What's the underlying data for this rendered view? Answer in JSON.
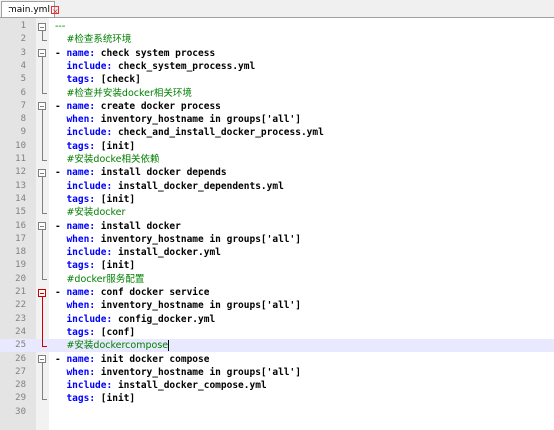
{
  "tab": {
    "filename": "main.yml",
    "close_icon": "close-icon",
    "file_icon": "file-icon"
  },
  "lines": [
    {
      "n": "1",
      "parts": [
        {
          "t": "---",
          "cls": "c"
        }
      ]
    },
    {
      "n": "2",
      "parts": [
        {
          "t": "  ",
          "cls": ""
        },
        {
          "t": "#检查系统环境",
          "cls": "c"
        }
      ]
    },
    {
      "n": "3",
      "parts": [
        {
          "t": "- ",
          "cls": ""
        },
        {
          "t": "name:",
          "cls": "k"
        },
        {
          "t": " check system process",
          "cls": ""
        }
      ]
    },
    {
      "n": "4",
      "parts": [
        {
          "t": "  ",
          "cls": ""
        },
        {
          "t": "include:",
          "cls": "k"
        },
        {
          "t": " check_system_process.yml",
          "cls": ""
        }
      ]
    },
    {
      "n": "5",
      "parts": [
        {
          "t": "  ",
          "cls": ""
        },
        {
          "t": "tags:",
          "cls": "k"
        },
        {
          "t": " [check]",
          "cls": ""
        }
      ]
    },
    {
      "n": "6",
      "parts": [
        {
          "t": "  ",
          "cls": ""
        },
        {
          "t": "#检查并安装docker相关环境",
          "cls": "c"
        }
      ]
    },
    {
      "n": "7",
      "parts": [
        {
          "t": "- ",
          "cls": ""
        },
        {
          "t": "name:",
          "cls": "k"
        },
        {
          "t": " create docker process",
          "cls": ""
        }
      ]
    },
    {
      "n": "8",
      "parts": [
        {
          "t": "  ",
          "cls": ""
        },
        {
          "t": "when:",
          "cls": "k"
        },
        {
          "t": " inventory_hostname in groups['all']",
          "cls": ""
        }
      ]
    },
    {
      "n": "9",
      "parts": [
        {
          "t": "  ",
          "cls": ""
        },
        {
          "t": "include:",
          "cls": "k"
        },
        {
          "t": " check_and_install_docker_process.yml",
          "cls": ""
        }
      ]
    },
    {
      "n": "10",
      "parts": [
        {
          "t": "  ",
          "cls": ""
        },
        {
          "t": "tags:",
          "cls": "k"
        },
        {
          "t": " [init]",
          "cls": ""
        }
      ]
    },
    {
      "n": "11",
      "parts": [
        {
          "t": "  ",
          "cls": ""
        },
        {
          "t": "#安装docke相关依赖",
          "cls": "c"
        }
      ]
    },
    {
      "n": "12",
      "parts": [
        {
          "t": "- ",
          "cls": ""
        },
        {
          "t": "name:",
          "cls": "k"
        },
        {
          "t": " install docker depends",
          "cls": ""
        }
      ]
    },
    {
      "n": "13",
      "parts": [
        {
          "t": "  ",
          "cls": ""
        },
        {
          "t": "include:",
          "cls": "k"
        },
        {
          "t": " install_docker_dependents.yml",
          "cls": ""
        }
      ]
    },
    {
      "n": "14",
      "parts": [
        {
          "t": "  ",
          "cls": ""
        },
        {
          "t": "tags:",
          "cls": "k"
        },
        {
          "t": " [init]",
          "cls": ""
        }
      ]
    },
    {
      "n": "15",
      "parts": [
        {
          "t": "  ",
          "cls": ""
        },
        {
          "t": "#安装docker",
          "cls": "c"
        }
      ]
    },
    {
      "n": "16",
      "parts": [
        {
          "t": "- ",
          "cls": ""
        },
        {
          "t": "name:",
          "cls": "k"
        },
        {
          "t": " install docker",
          "cls": ""
        }
      ]
    },
    {
      "n": "17",
      "parts": [
        {
          "t": "  ",
          "cls": ""
        },
        {
          "t": "when:",
          "cls": "k"
        },
        {
          "t": " inventory_hostname in groups['all']",
          "cls": ""
        }
      ]
    },
    {
      "n": "18",
      "parts": [
        {
          "t": "  ",
          "cls": ""
        },
        {
          "t": "include:",
          "cls": "k"
        },
        {
          "t": " install_docker.yml",
          "cls": ""
        }
      ]
    },
    {
      "n": "19",
      "parts": [
        {
          "t": "  ",
          "cls": ""
        },
        {
          "t": "tags:",
          "cls": "k"
        },
        {
          "t": " [init]",
          "cls": ""
        }
      ]
    },
    {
      "n": "20",
      "parts": [
        {
          "t": "  ",
          "cls": ""
        },
        {
          "t": "#docker服务配置",
          "cls": "c"
        }
      ]
    },
    {
      "n": "21",
      "parts": [
        {
          "t": "- ",
          "cls": ""
        },
        {
          "t": "name:",
          "cls": "k"
        },
        {
          "t": " conf docker service",
          "cls": ""
        }
      ]
    },
    {
      "n": "22",
      "parts": [
        {
          "t": "  ",
          "cls": ""
        },
        {
          "t": "when:",
          "cls": "k"
        },
        {
          "t": " inventory_hostname in groups['all']",
          "cls": ""
        }
      ]
    },
    {
      "n": "23",
      "parts": [
        {
          "t": "  ",
          "cls": ""
        },
        {
          "t": "include:",
          "cls": "k"
        },
        {
          "t": " config_docker.yml",
          "cls": ""
        }
      ]
    },
    {
      "n": "24",
      "parts": [
        {
          "t": "  ",
          "cls": ""
        },
        {
          "t": "tags:",
          "cls": "k"
        },
        {
          "t": " [conf]",
          "cls": ""
        }
      ]
    },
    {
      "n": "25",
      "parts": [
        {
          "t": "  ",
          "cls": ""
        },
        {
          "t": "#安装dockercompose",
          "cls": "c"
        }
      ]
    },
    {
      "n": "26",
      "parts": [
        {
          "t": "- ",
          "cls": ""
        },
        {
          "t": "name:",
          "cls": "k"
        },
        {
          "t": " init docker compose",
          "cls": ""
        }
      ]
    },
    {
      "n": "27",
      "parts": [
        {
          "t": "  ",
          "cls": ""
        },
        {
          "t": "when:",
          "cls": "k"
        },
        {
          "t": " inventory_hostname in groups['all']",
          "cls": ""
        }
      ]
    },
    {
      "n": "28",
      "parts": [
        {
          "t": "  ",
          "cls": ""
        },
        {
          "t": "include:",
          "cls": "k"
        },
        {
          "t": " install_docker_compose.yml",
          "cls": ""
        }
      ]
    },
    {
      "n": "29",
      "parts": [
        {
          "t": "  ",
          "cls": ""
        },
        {
          "t": "tags:",
          "cls": "k"
        },
        {
          "t": " [init]",
          "cls": ""
        }
      ]
    },
    {
      "n": "30",
      "parts": []
    }
  ],
  "current_line": "25",
  "colors": {
    "keyword": "#0000ff",
    "comment": "#008000",
    "fold_active": "#d00000",
    "current_line_bg": "#e8e8ff"
  }
}
